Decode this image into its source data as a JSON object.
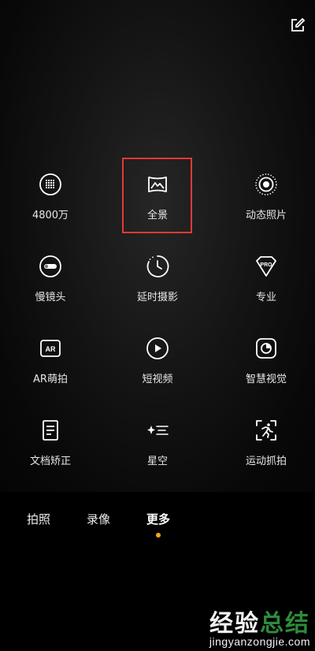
{
  "header": {
    "edit_icon": "edit-icon"
  },
  "modes": [
    {
      "label": "4800万",
      "icon": "grid-icon"
    },
    {
      "label": "全景",
      "icon": "panorama-icon",
      "selected": true
    },
    {
      "label": "动态照片",
      "icon": "live-photo-icon"
    },
    {
      "label": "慢镜头",
      "icon": "slow-motion-icon"
    },
    {
      "label": "延时摄影",
      "icon": "timelapse-icon"
    },
    {
      "label": "专业",
      "icon": "pro-icon",
      "badge": "PRO"
    },
    {
      "label": "AR萌拍",
      "icon": "ar-icon",
      "badge": "AR"
    },
    {
      "label": "短视频",
      "icon": "short-video-icon"
    },
    {
      "label": "智慧视觉",
      "icon": "smart-vision-icon"
    },
    {
      "label": "文档矫正",
      "icon": "document-icon"
    },
    {
      "label": "星空",
      "icon": "starry-sky-icon"
    },
    {
      "label": "运动抓拍",
      "icon": "sports-snap-icon"
    }
  ],
  "tabs": [
    {
      "label": "拍照"
    },
    {
      "label": "录像"
    },
    {
      "label": "更多",
      "active": true
    }
  ],
  "colors": {
    "active_dot": "#f5a623",
    "highlight_border": "#e53935",
    "watermark_accent": "#2e8b3a"
  },
  "watermark": {
    "title_a": "经验",
    "title_b": "总结",
    "url": "jingyanzongjie.com"
  }
}
